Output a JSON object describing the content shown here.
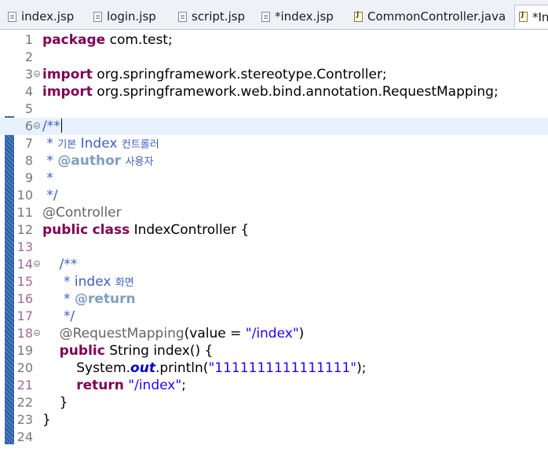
{
  "tabs": [
    {
      "label": "index.jsp",
      "icon": "jsp-file-icon"
    },
    {
      "label": "login.jsp",
      "icon": "jsp-file-icon"
    },
    {
      "label": "script.jsp",
      "icon": "jsp-file-icon"
    },
    {
      "label": "*index.jsp",
      "icon": "jsp-file-icon"
    },
    {
      "label": "CommonController.java",
      "icon": "java-file-icon"
    },
    {
      "label": "*In",
      "icon": "java-file-icon",
      "active": true
    }
  ],
  "editor": {
    "line_numbers": [
      "1",
      "2",
      "3",
      "4",
      "5",
      "6",
      "7",
      "8",
      "9",
      "10",
      "11",
      "12",
      "13",
      "14",
      "15",
      "16",
      "17",
      "18",
      "19",
      "20",
      "21",
      "22",
      "23",
      "24"
    ],
    "current_line": 6,
    "tokens": {
      "l1_kw": "package",
      "l1_rest": " com.test;",
      "l3_kw": "import",
      "l3_rest": " org.springframework.stereotype.Controller;",
      "l4_kw": "import",
      "l4_rest": " org.springframework.web.bind.annotation.RequestMapping;",
      "l6_jd": "/**",
      "l7_star": " * ",
      "l7_ko1": "기본",
      "l7_word": " Index ",
      "l7_ko2": "컨트롤러",
      "l8_star": " * ",
      "l8_tag": "@author",
      "l8_sp": " ",
      "l8_ko": "사용자",
      "l9_jd": " *",
      "l10_jd": " */",
      "l11_ann": "@Controller",
      "l12_kw1": "public",
      "l12_sp": " ",
      "l12_kw2": "class",
      "l12_rest": " IndexController {",
      "l14_jd": "    /**",
      "l15_star": "     * index ",
      "l15_ko": "화면",
      "l16_star": "     * ",
      "l16_tag": "@return",
      "l17_jd": "     */",
      "l18_indent": "    ",
      "l18_ann": "@RequestMapping",
      "l18_mid": "(value = ",
      "l18_str": "\"/index\"",
      "l18_end": ")",
      "l19_indent": "    ",
      "l19_kw": "public",
      "l19_rest": " String index() {",
      "l20_indent": "        System.",
      "l20_field": "out",
      "l20_mid": ".println(",
      "l20_str": "\"1111111111111111\"",
      "l20_end": ");",
      "l21_indent": "        ",
      "l21_kw": "return",
      "l21_sp": " ",
      "l21_str": "\"/index\"",
      "l21_end": ";",
      "l22": "    }",
      "l23": "}"
    },
    "colors": {
      "keyword": "#7f0055",
      "annotation": "#646464",
      "string": "#2a00ff",
      "javadoc": "#3f5fbf",
      "javadoc_tag": "#7f9fbf",
      "static_field": "#0000c0",
      "current_line": "#e8f2fe"
    }
  }
}
